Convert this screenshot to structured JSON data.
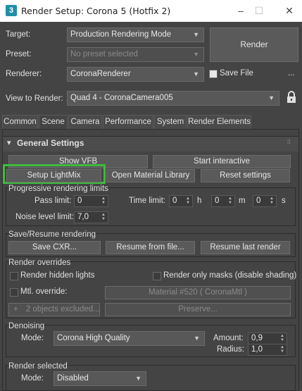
{
  "window": {
    "title": "Render Setup: Corona 5 (Hotfix 2)",
    "app_icon": "3",
    "controls": [
      "–",
      "☐",
      "✕"
    ]
  },
  "header": {
    "target_label": "Target:",
    "target_value": "Production Rendering Mode",
    "preset_label": "Preset:",
    "preset_value": "No preset selected",
    "renderer_label": "Renderer:",
    "renderer_value": "CoronaRenderer",
    "save_file_label": "Save File",
    "more_label": "...",
    "view_label": "View to Render:",
    "view_value": "Quad 4 - CoronaCamera005",
    "render_button": "Render"
  },
  "tabs": [
    "Common",
    "Scene",
    "Camera",
    "Performance",
    "System",
    "Render Elements"
  ],
  "general": {
    "title": "General Settings",
    "collapse": "▾",
    "show_vfb": "Show VFB",
    "start_interactive": "Start interactive",
    "setup_lightmix": "Setup LightMix",
    "open_material_library": "Open Material Library",
    "reset_settings": "Reset settings"
  },
  "progressive": {
    "title": "Progressive rendering limits",
    "pass_limit_label": "Pass limit:",
    "pass_limit": "0",
    "time_limit_label": "Time limit:",
    "hours": "0",
    "h": "h",
    "minutes": "0",
    "m": "m",
    "seconds": "0",
    "s": "s",
    "noise_label": "Noise level limit:",
    "noise": "7,0"
  },
  "save_resume": {
    "title": "Save/Resume rendering",
    "save_cxr": "Save CXR...",
    "resume_file": "Resume from file...",
    "resume_last": "Resume last render"
  },
  "overrides": {
    "title": "Render overrides",
    "hidden_lights": "Render hidden lights",
    "only_masks": "Render only masks (disable shading)",
    "mtl_override": "Mtl. override:",
    "material": "Material #520  ( CoronaMtl )",
    "plus": "+",
    "excluded": "2 objects excluded...",
    "preserve": "Preserve..."
  },
  "denoising": {
    "title": "Denoising",
    "mode_label": "Mode:",
    "mode": "Corona High Quality",
    "amount_label": "Amount:",
    "amount": "0,9",
    "radius_label": "Radius:",
    "radius": "1,0"
  },
  "render_selected": {
    "title": "Render selected",
    "mode_label": "Mode:",
    "mode": "Disabled"
  },
  "colors": {
    "background": "#444444",
    "highlight": "#3dbb3d",
    "titlebar": "#ffffff"
  }
}
